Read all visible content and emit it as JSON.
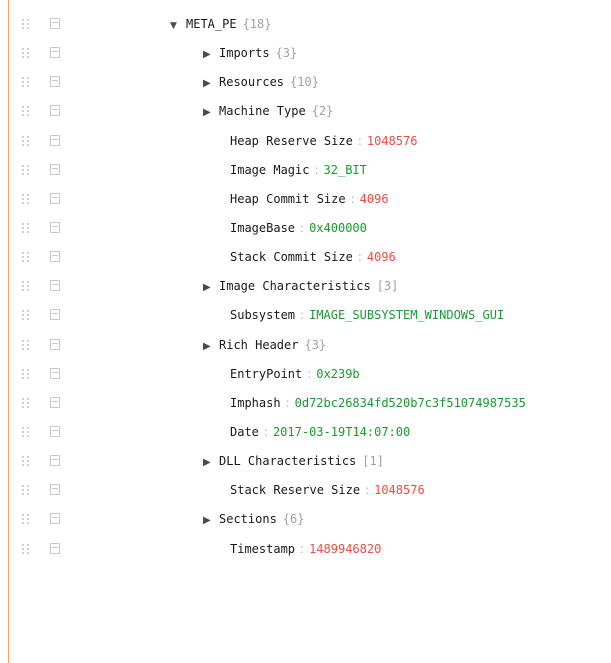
{
  "root": {
    "key": "META_PE",
    "count": "{18}"
  },
  "rows": [
    {
      "kind": "branch",
      "key": "Imports",
      "count": "{3}"
    },
    {
      "kind": "branch",
      "key": "Resources",
      "count": "{10}"
    },
    {
      "kind": "branch",
      "key": "Machine Type",
      "count": "{2}"
    },
    {
      "kind": "leaf",
      "key": "Heap Reserve Size",
      "value": "1048576",
      "vtype": "num"
    },
    {
      "kind": "leaf",
      "key": "Image Magic",
      "value": "32_BIT",
      "vtype": "str"
    },
    {
      "kind": "leaf",
      "key": "Heap Commit Size",
      "value": "4096",
      "vtype": "num"
    },
    {
      "kind": "leaf",
      "key": "ImageBase",
      "value": "0x400000",
      "vtype": "str"
    },
    {
      "kind": "leaf",
      "key": "Stack Commit Size",
      "value": "4096",
      "vtype": "num"
    },
    {
      "kind": "branch",
      "key": "Image Characteristics",
      "count": "[3]"
    },
    {
      "kind": "leaf",
      "key": "Subsystem",
      "value": "IMAGE_SUBSYSTEM_WINDOWS_GUI",
      "vtype": "str"
    },
    {
      "kind": "branch",
      "key": "Rich Header",
      "count": "{3}"
    },
    {
      "kind": "leaf",
      "key": "EntryPoint",
      "value": "0x239b",
      "vtype": "str"
    },
    {
      "kind": "leaf",
      "key": "Imphash",
      "value": "0d72bc26834fd520b7c3f51074987535",
      "vtype": "str"
    },
    {
      "kind": "leaf",
      "key": "Date",
      "value": "2017-03-19T14:07:00",
      "vtype": "str"
    },
    {
      "kind": "branch",
      "key": "DLL Characteristics",
      "count": "[1]"
    },
    {
      "kind": "leaf",
      "key": "Stack Reserve Size",
      "value": "1048576",
      "vtype": "num"
    },
    {
      "kind": "branch",
      "key": "Sections",
      "count": "{6}"
    },
    {
      "kind": "leaf",
      "key": "Timestamp",
      "value": "1489946820",
      "vtype": "num"
    }
  ],
  "icons": {
    "expanded": "triangle-down-icon",
    "collapsed": "triangle-right-icon",
    "drag": "drag-handle-icon",
    "context": "context-menu-icon"
  },
  "colors": {
    "number": "#ee4c45",
    "string": "#1a9a2f",
    "count": "#a0a0a0",
    "rule": "#f0a35e"
  }
}
